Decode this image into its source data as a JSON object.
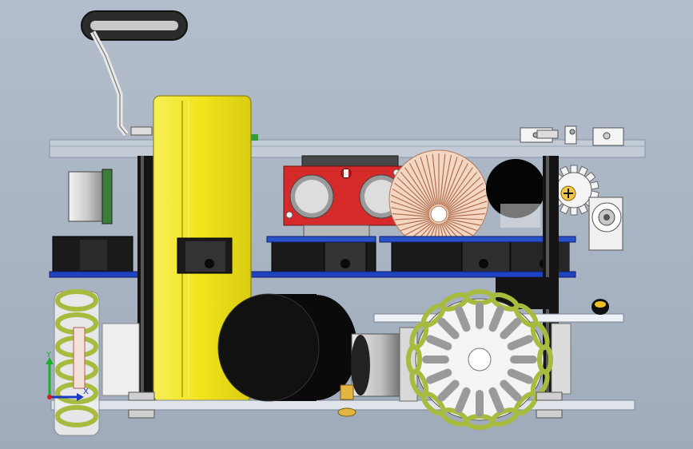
{
  "viewport": {
    "title": ""
  },
  "triad": {
    "y_label": "Y",
    "x_label": "X"
  },
  "colors": {
    "background": "#aab5c4",
    "battery_yellow": "#f2e61e",
    "pcb_blue": "#1f43c0",
    "sensor_red": "#d62a2a",
    "wheel_roller": "#a7bb3e",
    "motor_black": "#0a0a0a"
  },
  "parts": [
    {
      "name": "handle",
      "icon": "handle-icon"
    },
    {
      "name": "battery-pack",
      "icon": "battery-icon"
    },
    {
      "name": "ultrasonic-sensor",
      "icon": "ultrasonic-icon"
    },
    {
      "name": "toroid-coil",
      "icon": "coil-icon"
    },
    {
      "name": "drive-motor",
      "icon": "motor-icon"
    },
    {
      "name": "omni-wheel",
      "icon": "omni-wheel-icon"
    },
    {
      "name": "gear",
      "icon": "gear-icon"
    }
  ]
}
